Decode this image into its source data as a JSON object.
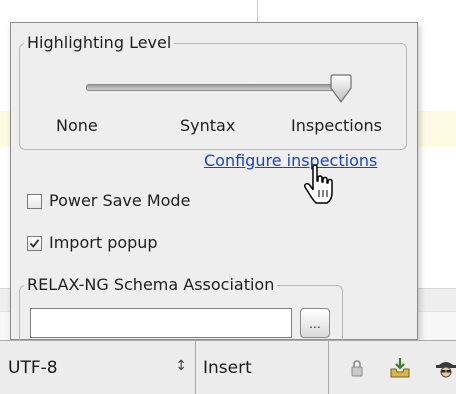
{
  "highlighting": {
    "legend": "Highlighting Level",
    "levels": [
      "None",
      "Syntax",
      "Inspections"
    ],
    "selected_level": "Inspections",
    "selected_index": 2
  },
  "configure_link": "Configure inspections",
  "power_save": {
    "label": "Power Save Mode",
    "checked": false
  },
  "import_popup": {
    "label": "Import popup",
    "checked": true
  },
  "relax": {
    "legend": "RELAX-NG Schema Association",
    "value": "",
    "browse_label": "..."
  },
  "statusbar": {
    "encoding": "UTF-8",
    "insert_mode": "Insert"
  },
  "colors": {
    "link": "#1a44c8",
    "panel_bg": "#eeeeee",
    "caret_row": "#fdfbe2"
  },
  "icons": {
    "slider_knob": "slider-thumb-icon",
    "cursor": "hand-pointer-icon",
    "lock": "lock-icon",
    "inbox": "inbox-download-icon",
    "inspector": "hector-inspector-icon"
  }
}
